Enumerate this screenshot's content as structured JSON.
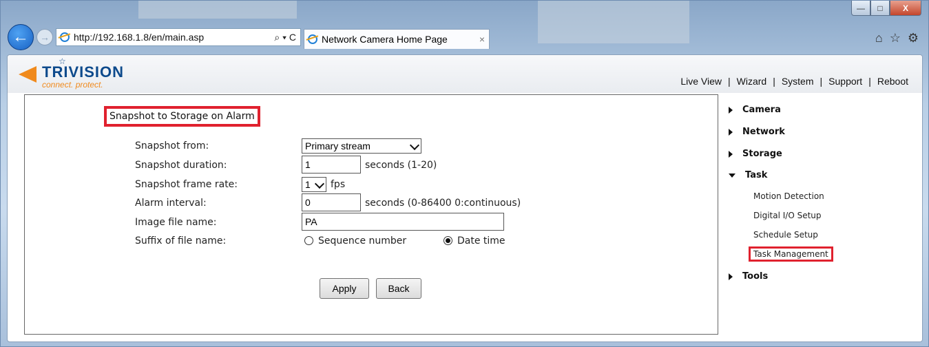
{
  "browser": {
    "address_url": "http://192.168.1.8/en/main.asp",
    "address_controls": "⌕ ▾ C",
    "tab_title": "Network Camera Home Page",
    "tab_close": "×",
    "window_controls": [
      "—",
      "□",
      "X"
    ],
    "toolbar_icons": [
      "home-icon",
      "favorites-star-icon",
      "gear-icon"
    ]
  },
  "logo": {
    "name": "TRIVISION",
    "tagline": "connect. protect."
  },
  "topnav": {
    "items": [
      "Live View",
      "Wizard",
      "System",
      "Support",
      "Reboot"
    ]
  },
  "form": {
    "title": "Snapshot to Storage on Alarm",
    "snapshot_from": {
      "label": "Snapshot from:",
      "value": "Primary stream"
    },
    "snapshot_duration": {
      "label": "Snapshot duration:",
      "value": "1",
      "hint": "seconds (1-20)"
    },
    "frame_rate": {
      "label": "Snapshot frame rate:",
      "value": "1",
      "unit": "fps"
    },
    "alarm_interval": {
      "label": "Alarm interval:",
      "value": "0",
      "hint": "seconds (0-86400 0:continuous)"
    },
    "file_name": {
      "label": "Image file name:",
      "value": "PA"
    },
    "suffix": {
      "label": "Suffix of file name:",
      "options": [
        "Sequence number",
        "Date time"
      ],
      "selected": "Date time"
    },
    "apply_label": "Apply",
    "back_label": "Back"
  },
  "menu": {
    "camera": "Camera",
    "network": "Network",
    "storage": "Storage",
    "task": "Task",
    "task_items": [
      "Motion Detection",
      "Digital I/O Setup",
      "Schedule Setup",
      "Task Management"
    ],
    "tools": "Tools"
  },
  "colors": {
    "highlight": "#e0212e",
    "logo_blue": "#0d4a8c",
    "logo_orange": "#f08a1d"
  }
}
